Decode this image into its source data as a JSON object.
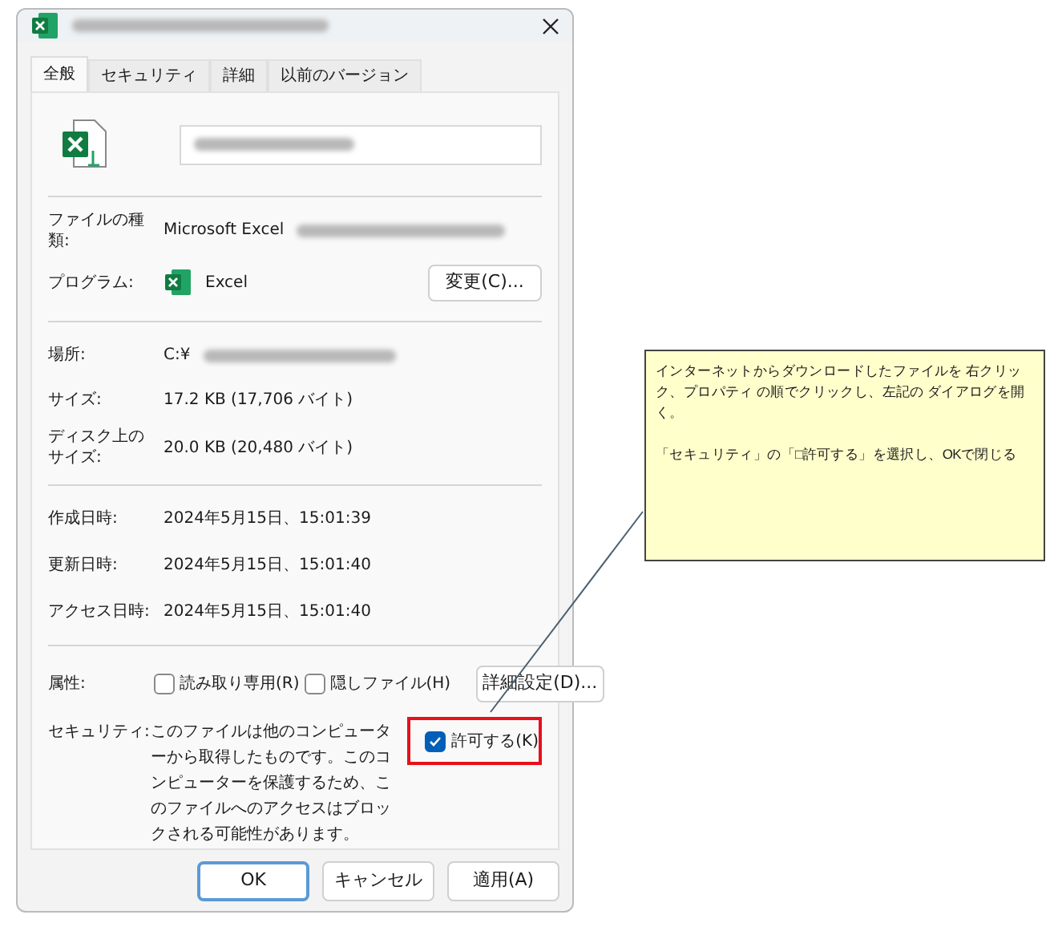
{
  "tabs": [
    {
      "label": "全般",
      "selected": true
    },
    {
      "label": "セキュリティ",
      "selected": false
    },
    {
      "label": "詳細",
      "selected": false
    },
    {
      "label": "以前のバージョン",
      "selected": false
    }
  ],
  "file_type": {
    "label": "ファイルの種類:",
    "value": "Microsoft Excel"
  },
  "program": {
    "label": "プログラム:",
    "value": "Excel",
    "button": "変更(C)..."
  },
  "location": {
    "label": "場所:",
    "value": "C:¥"
  },
  "sizes": [
    {
      "label": "サイズ:",
      "value": "17.2 KB (17,706 バイト)"
    },
    {
      "label": "ディスク上のサイズ:",
      "value": "20.0 KB (20,480 バイト)"
    }
  ],
  "dates": [
    {
      "label": "作成日時:",
      "value": "2024年5月15日、15:01:39"
    },
    {
      "label": "更新日時:",
      "value": "2024年5月15日、15:01:40"
    },
    {
      "label": "アクセス日時:",
      "value": "2024年5月15日、15:01:40"
    }
  ],
  "attributes": {
    "label": "属性:",
    "checkboxes": [
      {
        "label": "読み取り専用(R)",
        "checked": false
      },
      {
        "label": "隠しファイル(H)",
        "checked": false
      }
    ],
    "button": "詳細設定(D)..."
  },
  "security": {
    "label": "セキュリティ:",
    "text": "このファイルは他のコンピューターから取得したものです。このコンピューターを保護するため、このファイルへのアクセスはブロックされる可能性があります。",
    "checkbox": {
      "label": "許可する(K)",
      "checked": true
    }
  },
  "buttons": [
    {
      "label": "OK",
      "focused": true
    },
    {
      "label": "キャンセル",
      "focused": false
    },
    {
      "label": "適用(A)",
      "focused": false
    }
  ],
  "callout": {
    "paragraphs": [
      "インターネットからダウンロードしたファイルを 右クリック、プロパティ の順でクリックし、左記の ダイアログを開く。",
      "「セキュリティ」の「□許可する」を選択し、OKで閉じる"
    ]
  }
}
